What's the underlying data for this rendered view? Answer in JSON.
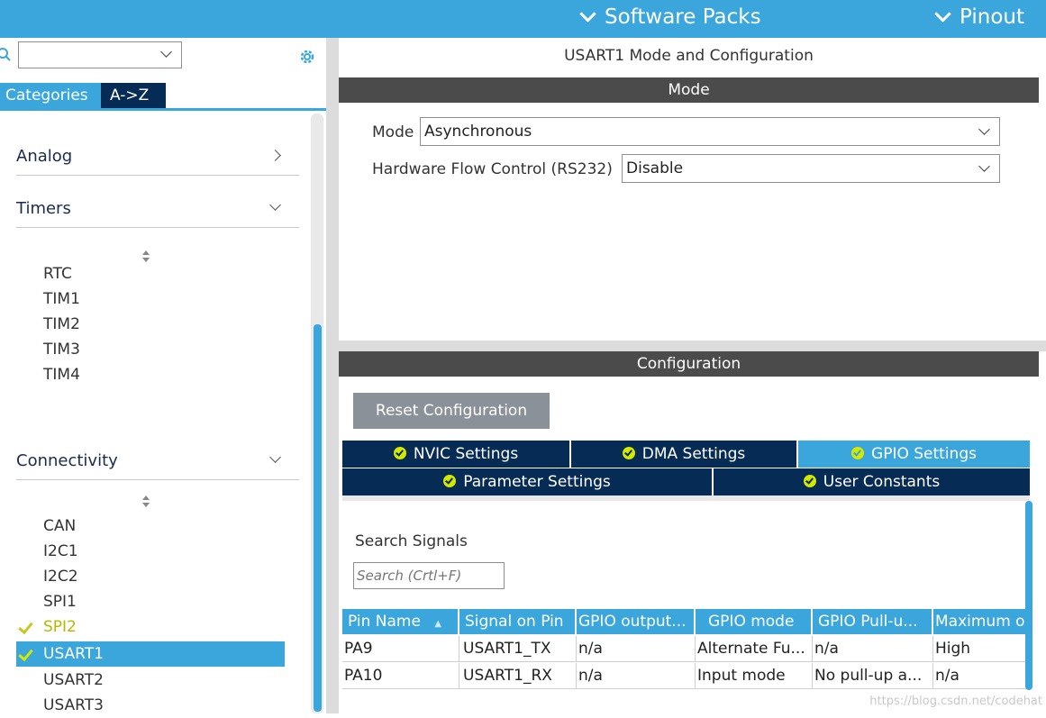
{
  "topbar": {
    "software_packs": "Software Packs",
    "pinout": "Pinout",
    "bg_color": "#3aa6dc"
  },
  "left": {
    "search_value": "",
    "tabs": [
      "Categories",
      "A->Z"
    ],
    "categories": {
      "analog": "Analog",
      "timers": "Timers",
      "connectivity": "Connectivity"
    },
    "timers_items": [
      "RTC",
      "TIM1",
      "TIM2",
      "TIM3",
      "TIM4"
    ],
    "connectivity_items": [
      {
        "label": "CAN",
        "state": "none"
      },
      {
        "label": "I2C1",
        "state": "none"
      },
      {
        "label": "I2C2",
        "state": "none"
      },
      {
        "label": "SPI1",
        "state": "none"
      },
      {
        "label": "SPI2",
        "state": "checked"
      },
      {
        "label": "USART1",
        "state": "selected-checked"
      },
      {
        "label": "USART2",
        "state": "none"
      },
      {
        "label": "USART3",
        "state": "none"
      }
    ]
  },
  "right": {
    "title": "USART1 Mode and Configuration",
    "mode_header": "Mode",
    "mode_label": "Mode",
    "mode_value": "Asynchronous",
    "hwflow_label": "Hardware Flow Control (RS232)",
    "hwflow_value": "Disable",
    "config_header": "Configuration",
    "reset_button": "Reset Configuration",
    "tabs_row1": [
      "NVIC Settings",
      "DMA Settings",
      "GPIO Settings"
    ],
    "tabs_row2": [
      "Parameter Settings",
      "User Constants"
    ],
    "active_tab": "GPIO Settings",
    "search_signals_label": "Search Signals",
    "search_placeholder": "Search (Crtl+F)",
    "table": {
      "headers": [
        "Pin Name",
        "Signal on Pin",
        "GPIO output...",
        "GPIO mode",
        "GPIO Pull-u...",
        "Maximum o"
      ],
      "rows": [
        [
          "PA9",
          "USART1_TX",
          "n/a",
          "Alternate Fu...",
          "n/a",
          "High"
        ],
        [
          "PA10",
          "USART1_RX",
          "n/a",
          "Input mode",
          "No pull-up a...",
          "n/a"
        ]
      ]
    },
    "watermark": "https://blog.csdn.net/codehat"
  }
}
